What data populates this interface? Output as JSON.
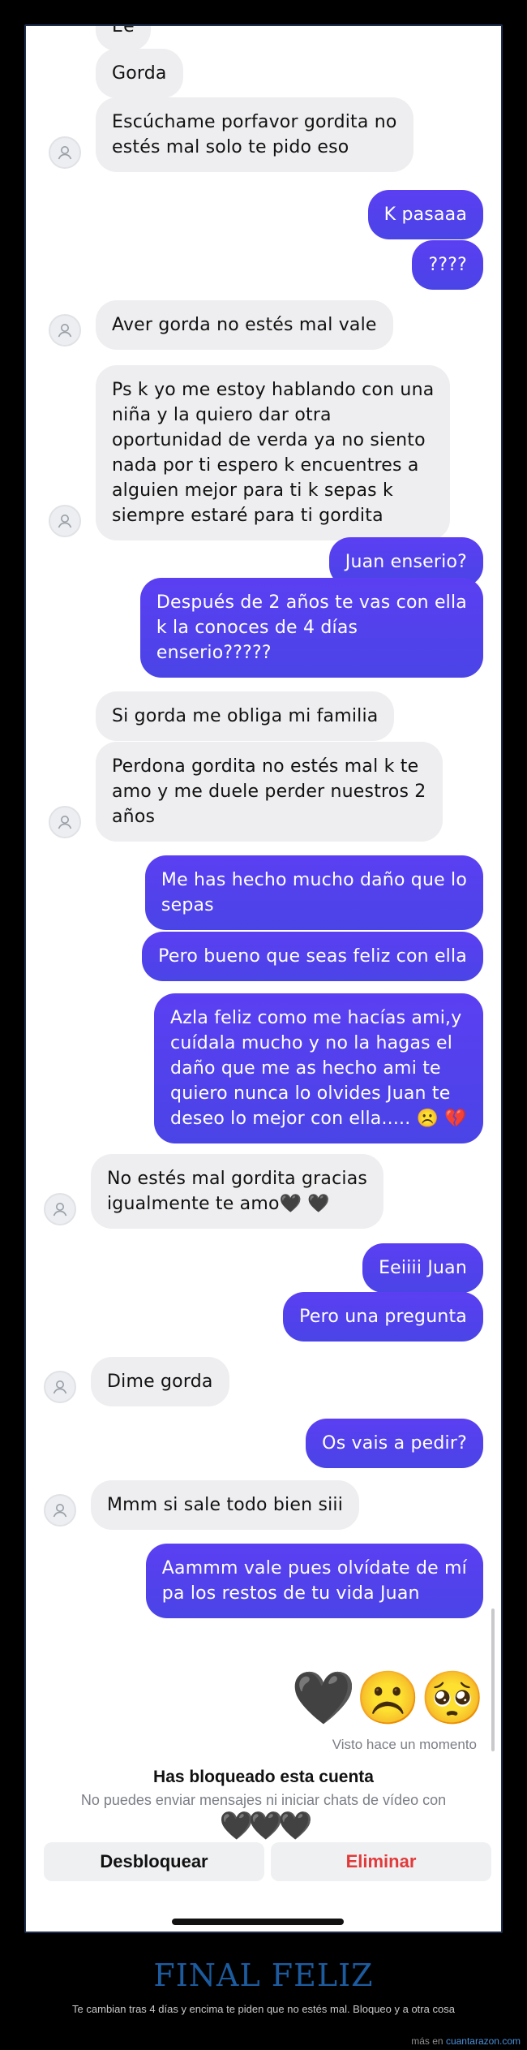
{
  "messages": [
    {
      "side": "in",
      "text": "Ee"
    },
    {
      "side": "in",
      "text": "Gorda"
    },
    {
      "side": "in",
      "text": "Escúchame porfavor gordita no\nestés mal solo te pido eso",
      "avatar": true
    },
    {
      "side": "out",
      "text": "K pasaaa"
    },
    {
      "side": "out",
      "text": "????"
    },
    {
      "side": "in",
      "text": "Aver gorda no estés mal vale",
      "avatar": true
    },
    {
      "side": "in",
      "text": "Ps k yo me estoy hablando con una\nniña y la quiero dar otra\noportunidad de verda ya no siento\nnada por ti espero k encuentres a\nalguien mejor para ti k sepas k\nsiempre estaré para ti gordita",
      "avatar": true
    },
    {
      "side": "out",
      "text": "Juan enserio?"
    },
    {
      "side": "out",
      "text": "Después de 2 años te vas con ella\nk la conoces de 4 días\nenserio?????"
    },
    {
      "side": "in",
      "text": "Si gorda me obliga mi familia"
    },
    {
      "side": "in",
      "text": "Perdona gordita no estés mal k te\namo y me duele perder nuestros 2\naños",
      "avatar": true
    },
    {
      "side": "out",
      "text": "Me has hecho mucho daño que lo\nsepas"
    },
    {
      "side": "out",
      "text": "Pero bueno que seas feliz con ella"
    },
    {
      "side": "out",
      "text": "Azla feliz como me hacías ami,y\ncuídala mucho y no la hagas el\ndaño que me as hecho ami te\nquiero nunca lo olvides Juan te\ndeseo lo mejor con ella..... ☹️ 💔"
    },
    {
      "side": "in",
      "text": "No estés mal gordita gracias\nigualmente te amo🖤 🖤",
      "avatar": true
    },
    {
      "side": "out",
      "text": "Eeiiii Juan"
    },
    {
      "side": "out",
      "text": "Pero una pregunta"
    },
    {
      "side": "in",
      "text": "Dime gorda",
      "avatar": true
    },
    {
      "side": "out",
      "text": "Os vais a pedir?"
    },
    {
      "side": "in",
      "text": "Mmm si sale todo bien siii",
      "avatar": true
    },
    {
      "side": "out",
      "text": "Aammm vale pues olvídate de mí\npa los restos de tu vida Juan"
    }
  ],
  "emoji_reaction": "🖤☹️🥺",
  "seen_status": "Visto hace un momento",
  "blocked": {
    "title": "Has bloqueado esta cuenta",
    "text": "No puedes enviar mensajes ni iniciar chats de vídeo con",
    "emojis": "🖤🖤🖤"
  },
  "buttons": {
    "unblock": "Desbloquear",
    "delete": "Eliminar"
  },
  "caption": {
    "title": "FINAL FELIZ",
    "subtitle": "Te cambian tras 4 días y encima te piden que no estés mal. Bloqueo y a otra cosa"
  },
  "footer": {
    "prefix": "más en",
    "site": "cuantarazon.com"
  },
  "colors": {
    "outgoing_bubble": "#5046ea",
    "incoming_bubble": "#eeeef0",
    "delete": "#e23a3a",
    "caption_title": "#1c5b9e"
  }
}
